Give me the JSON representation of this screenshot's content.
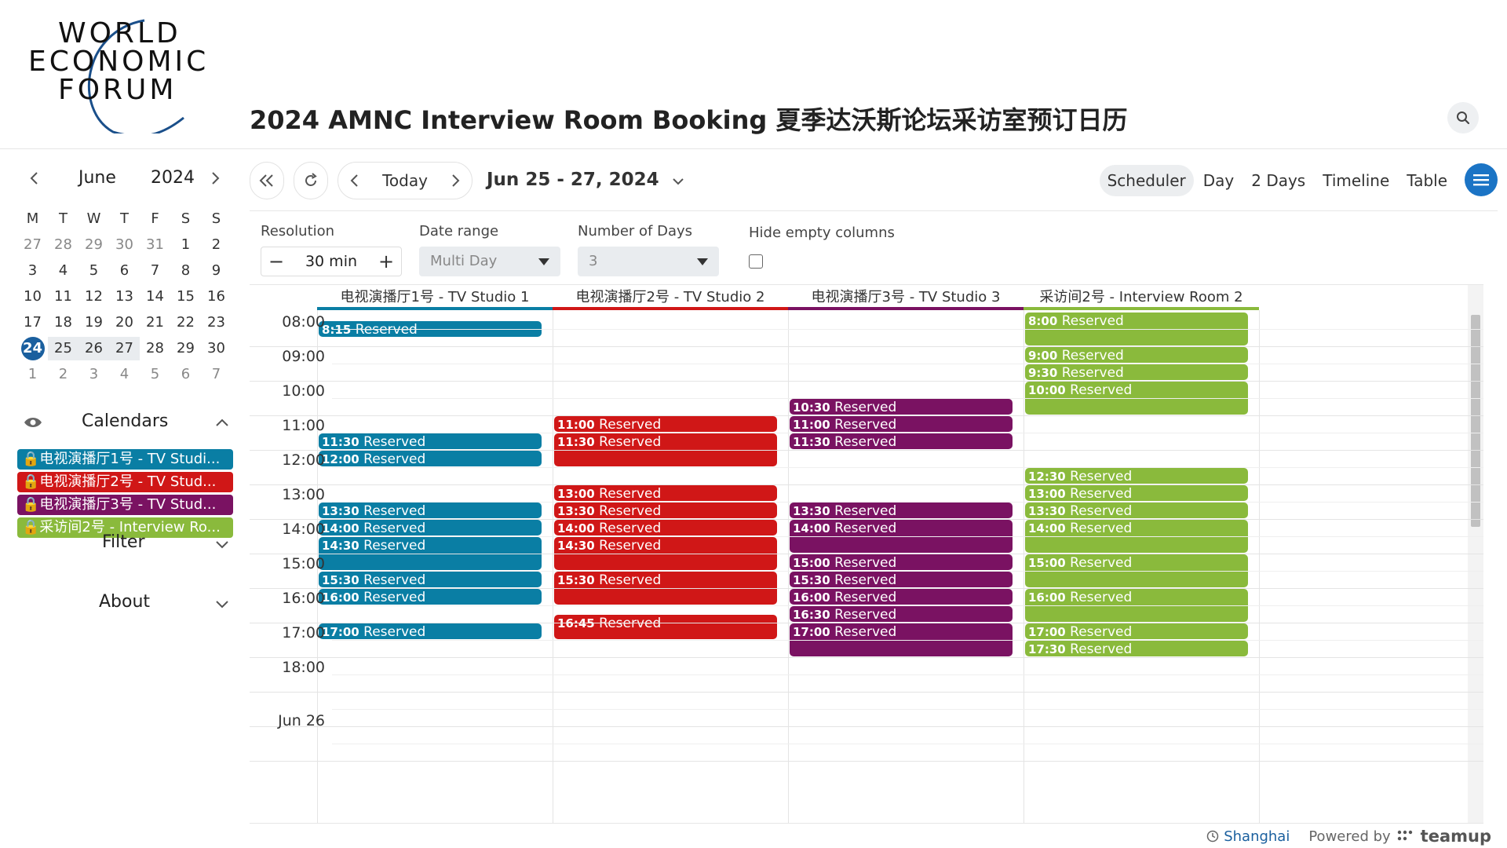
{
  "header": {
    "logo_lines": [
      "WORLD",
      "ECONOMIC",
      "FORUM"
    ],
    "title": "2024 AMNC Interview Room Booking 夏季达沃斯论坛采访室预订日历"
  },
  "mini_calendar": {
    "month": "June",
    "year": "2024",
    "weekdays": [
      "M",
      "T",
      "W",
      "T",
      "F",
      "S",
      "S"
    ],
    "weeks": [
      [
        "27",
        "28",
        "29",
        "30",
        "31",
        "1",
        "2"
      ],
      [
        "3",
        "4",
        "5",
        "6",
        "7",
        "8",
        "9"
      ],
      [
        "10",
        "11",
        "12",
        "13",
        "14",
        "15",
        "16"
      ],
      [
        "17",
        "18",
        "19",
        "20",
        "21",
        "22",
        "23"
      ],
      [
        "24",
        "25",
        "26",
        "27",
        "28",
        "29",
        "30"
      ],
      [
        "1",
        "2",
        "3",
        "4",
        "5",
        "6",
        "7"
      ]
    ]
  },
  "sidebar": {
    "calendars_label": "Calendars",
    "filter_label": "Filter",
    "about_label": "About",
    "calendars": [
      {
        "label": "电视演播厅1号 - TV Studi...",
        "color": "#0a7ea4"
      },
      {
        "label": "电视演播厅2号 - TV Stud...",
        "color": "#d01717"
      },
      {
        "label": "电视演播厅3号 - TV Stud...",
        "color": "#7a1262"
      },
      {
        "label": "采访间2号 - Interview Ro...",
        "color": "#8aba3c"
      }
    ]
  },
  "toolbar": {
    "today_label": "Today",
    "range_label": "Jun 25 - 27, 2024",
    "views": [
      "Scheduler",
      "Day",
      "2 Days",
      "Timeline",
      "Table"
    ],
    "active_view": "Scheduler"
  },
  "options": {
    "resolution_label": "Resolution",
    "resolution_value": "30 min",
    "date_range_label": "Date range",
    "date_range_value": "Multi Day",
    "days_label": "Number of Days",
    "days_value": "3",
    "hide_empty_label": "Hide empty columns"
  },
  "scheduler": {
    "columns": [
      {
        "name": "电视演播厅1号 - TV Studio 1",
        "color": "#0a7ea4"
      },
      {
        "name": "电视演播厅2号 - TV Studio 2",
        "color": "#d01717"
      },
      {
        "name": "电视演播厅3号 - TV Studio 3",
        "color": "#7a1262"
      },
      {
        "name": "采访间2号 - Interview Room 2",
        "color": "#8aba3c"
      }
    ],
    "hours": [
      "08:00",
      "09:00",
      "10:00",
      "11:00",
      "12:00",
      "13:00",
      "14:00",
      "15:00",
      "16:00",
      "17:00",
      "18:00"
    ],
    "next_day_label": "Jun 26",
    "events": [
      {
        "col": 0,
        "start": "8:15",
        "end": "8:45",
        "time": "8:15",
        "title": "Reserved"
      },
      {
        "col": 0,
        "start": "11:30",
        "end": "12:00",
        "time": "11:30",
        "title": "Reserved"
      },
      {
        "col": 0,
        "start": "12:00",
        "end": "12:30",
        "time": "12:00",
        "title": "Reserved"
      },
      {
        "col": 0,
        "start": "13:30",
        "end": "14:00",
        "time": "13:30",
        "title": "Reserved"
      },
      {
        "col": 0,
        "start": "14:00",
        "end": "14:30",
        "time": "14:00",
        "title": "Reserved"
      },
      {
        "col": 0,
        "start": "14:30",
        "end": "15:30",
        "time": "14:30",
        "title": "Reserved"
      },
      {
        "col": 0,
        "start": "15:30",
        "end": "16:00",
        "time": "15:30",
        "title": "Reserved"
      },
      {
        "col": 0,
        "start": "16:00",
        "end": "16:30",
        "time": "16:00",
        "title": "Reserved"
      },
      {
        "col": 0,
        "start": "17:00",
        "end": "17:30",
        "time": "17:00",
        "title": "Reserved"
      },
      {
        "col": 1,
        "start": "11:00",
        "end": "11:30",
        "time": "11:00",
        "title": "Reserved"
      },
      {
        "col": 1,
        "start": "11:30",
        "end": "12:30",
        "time": "11:30",
        "title": "Reserved"
      },
      {
        "col": 1,
        "start": "13:00",
        "end": "13:30",
        "time": "13:00",
        "title": "Reserved"
      },
      {
        "col": 1,
        "start": "13:30",
        "end": "14:00",
        "time": "13:30",
        "title": "Reserved"
      },
      {
        "col": 1,
        "start": "14:00",
        "end": "14:30",
        "time": "14:00",
        "title": "Reserved"
      },
      {
        "col": 1,
        "start": "14:30",
        "end": "15:30",
        "time": "14:30",
        "title": "Reserved"
      },
      {
        "col": 1,
        "start": "15:30",
        "end": "16:30",
        "time": "15:30",
        "title": "Reserved"
      },
      {
        "col": 1,
        "start": "16:45",
        "end": "17:30",
        "time": "16:45",
        "title": "Reserved"
      },
      {
        "col": 2,
        "start": "10:30",
        "end": "11:00",
        "time": "10:30",
        "title": "Reserved"
      },
      {
        "col": 2,
        "start": "11:00",
        "end": "11:30",
        "time": "11:00",
        "title": "Reserved"
      },
      {
        "col": 2,
        "start": "11:30",
        "end": "12:00",
        "time": "11:30",
        "title": "Reserved"
      },
      {
        "col": 2,
        "start": "13:30",
        "end": "14:00",
        "time": "13:30",
        "title": "Reserved"
      },
      {
        "col": 2,
        "start": "14:00",
        "end": "15:00",
        "time": "14:00",
        "title": "Reserved"
      },
      {
        "col": 2,
        "start": "15:00",
        "end": "15:30",
        "time": "15:00",
        "title": "Reserved"
      },
      {
        "col": 2,
        "start": "15:30",
        "end": "16:00",
        "time": "15:30",
        "title": "Reserved"
      },
      {
        "col": 2,
        "start": "16:00",
        "end": "16:30",
        "time": "16:00",
        "title": "Reserved"
      },
      {
        "col": 2,
        "start": "16:30",
        "end": "17:00",
        "time": "16:30",
        "title": "Reserved"
      },
      {
        "col": 2,
        "start": "17:00",
        "end": "18:00",
        "time": "17:00",
        "title": "Reserved"
      },
      {
        "col": 3,
        "start": "8:00",
        "end": "9:00",
        "time": "8:00",
        "title": "Reserved"
      },
      {
        "col": 3,
        "start": "9:00",
        "end": "9:30",
        "time": "9:00",
        "title": "Reserved"
      },
      {
        "col": 3,
        "start": "9:30",
        "end": "10:00",
        "time": "9:30",
        "title": "Reserved"
      },
      {
        "col": 3,
        "start": "10:00",
        "end": "11:00",
        "time": "10:00",
        "title": "Reserved"
      },
      {
        "col": 3,
        "start": "12:30",
        "end": "13:00",
        "time": "12:30",
        "title": "Reserved"
      },
      {
        "col": 3,
        "start": "13:00",
        "end": "13:30",
        "time": "13:00",
        "title": "Reserved"
      },
      {
        "col": 3,
        "start": "13:30",
        "end": "14:00",
        "time": "13:30",
        "title": "Reserved"
      },
      {
        "col": 3,
        "start": "14:00",
        "end": "15:00",
        "time": "14:00",
        "title": "Reserved"
      },
      {
        "col": 3,
        "start": "15:00",
        "end": "16:00",
        "time": "15:00",
        "title": "Reserved"
      },
      {
        "col": 3,
        "start": "16:00",
        "end": "17:00",
        "time": "16:00",
        "title": "Reserved"
      },
      {
        "col": 3,
        "start": "17:00",
        "end": "17:30",
        "time": "17:00",
        "title": "Reserved"
      },
      {
        "col": 3,
        "start": "17:30",
        "end": "18:00",
        "time": "17:30",
        "title": "Reserved"
      }
    ]
  },
  "footer": {
    "location": "Shanghai",
    "powered_by": "Powered by",
    "brand": "teamup"
  }
}
